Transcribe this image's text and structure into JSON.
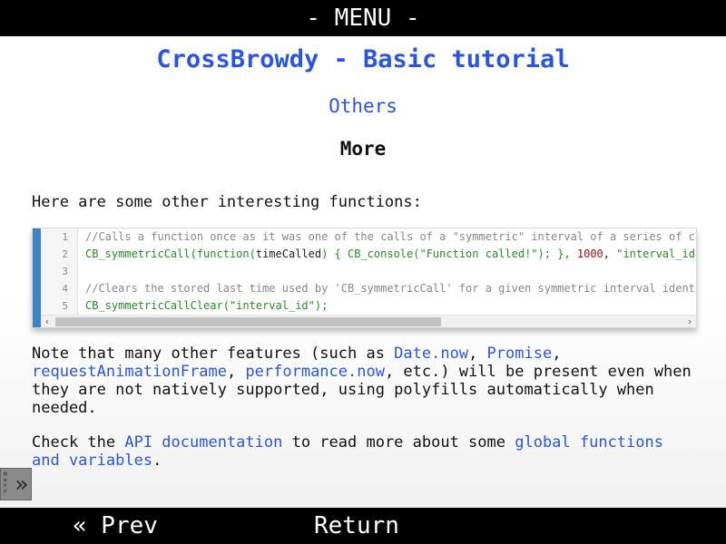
{
  "top_bar": {
    "label": "- MENU -"
  },
  "page": {
    "title": "CrossBrowdy - Basic tutorial",
    "section": "Others",
    "subsection": "More"
  },
  "intro": "Here are some other interesting functions:",
  "code": {
    "lines": [
      {
        "n": "1",
        "parts": [
          {
            "t": "//Calls a function once as it was one of the calls of a \"symmetric\" interval of a series of call",
            "c": "cm"
          }
        ]
      },
      {
        "n": "2",
        "parts": [
          {
            "t": "CB_symmetricCall(function(",
            "c": "fn"
          },
          {
            "t": "timeCalled",
            "c": "pl"
          },
          {
            "t": ") { CB_console(",
            "c": "fn"
          },
          {
            "t": "\"Function called!\"",
            "c": "str"
          },
          {
            "t": "); }, ",
            "c": "fn"
          },
          {
            "t": "1000",
            "c": "num"
          },
          {
            "t": ", ",
            "c": "pl"
          },
          {
            "t": "\"interval_id\"",
            "c": "str"
          },
          {
            "t": ");",
            "c": "fn"
          }
        ]
      },
      {
        "n": "3",
        "parts": []
      },
      {
        "n": "4",
        "parts": [
          {
            "t": "//Clears the stored last time used by 'CB_symmetricCall' for a given symmetric interval identifi",
            "c": "cm"
          }
        ]
      },
      {
        "n": "5",
        "parts": [
          {
            "t": "CB_symmetricCallClear(",
            "c": "fn"
          },
          {
            "t": "\"interval_id\"",
            "c": "str"
          },
          {
            "t": ");",
            "c": "fn"
          }
        ]
      }
    ]
  },
  "note": {
    "t1": "Note that many other features (such as ",
    "l1": "Date.now",
    "t2": ", ",
    "l2": "Promise",
    "t3": ",",
    "l3": "requestAnimationFrame",
    "t4": ", ",
    "l4": "performance.now",
    "t5": ", etc.) will be present even when they are not natively supported, using polyfills automatically when needed."
  },
  "check": {
    "t1": "Check the ",
    "l1": "API documentation",
    "t2": " to read more about some ",
    "l2": "global functions and variables",
    "t3": "."
  },
  "side_handle": {
    "glyph": "»",
    "tiny": "Menu"
  },
  "bottom_bar": {
    "prev": "« Prev",
    "return": "Return"
  }
}
